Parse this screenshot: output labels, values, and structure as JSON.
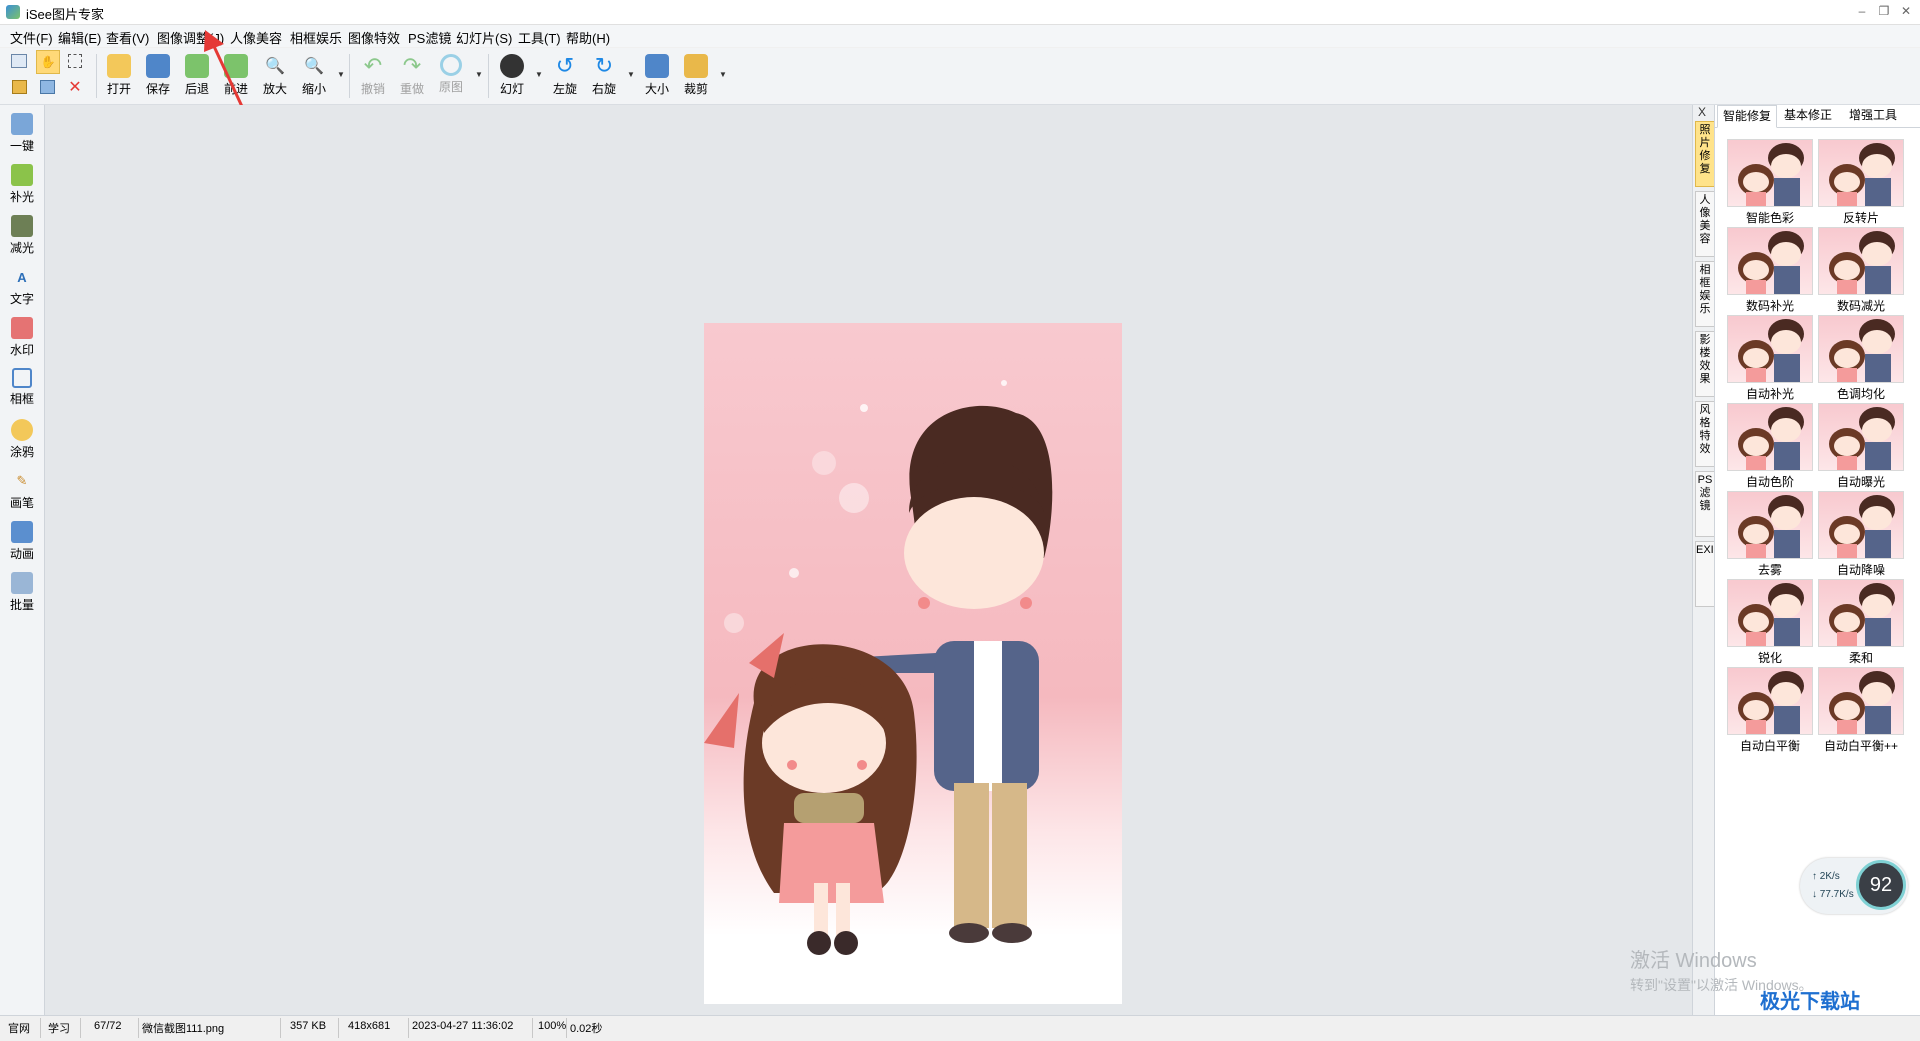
{
  "window": {
    "title": "iSee图片专家"
  },
  "menu": [
    "文件(F)",
    "编辑(E)",
    "查看(V)",
    "图像调整(J)",
    "人像美容",
    "相框娱乐",
    "图像特效",
    "PS滤镜",
    "幻灯片(S)",
    "工具(T)",
    "帮助(H)"
  ],
  "toolbar": {
    "open": "打开",
    "save": "保存",
    "back": "后退",
    "forward": "前进",
    "zoom_in": "放大",
    "zoom_out": "缩小",
    "undo": "撤销",
    "redo": "重做",
    "original": "原图",
    "slideshow": "幻灯",
    "rotate_left": "左旋",
    "rotate_right": "右旋",
    "resize": "大小",
    "crop": "裁剪"
  },
  "left_tools": [
    "一键",
    "补光",
    "减光",
    "文字",
    "水印",
    "相框",
    "涂鸦",
    "画笔",
    "动画",
    "批量"
  ],
  "side_tabs": {
    "close": "X",
    "items": [
      "照片修复",
      "人像美容",
      "相框娱乐",
      "影楼效果",
      "风格特效",
      "PS滤镜",
      "EXIF"
    ]
  },
  "right_panel": {
    "tabs": [
      "智能修复",
      "基本修正",
      "增强工具"
    ],
    "effects": [
      "智能色彩",
      "反转片",
      "数码补光",
      "数码减光",
      "自动补光",
      "色调均化",
      "自动色阶",
      "自动曝光",
      "去雾",
      "自动降噪",
      "锐化",
      "柔和",
      "自动白平衡",
      "自动白平衡++"
    ]
  },
  "status": {
    "site": "官网",
    "learn": "学习",
    "index": "67/72",
    "filename": "微信截图111.png",
    "filesize": "357 KB",
    "dimensions": "418x681",
    "datetime": "2023-04-27 11:36:02",
    "zoom": "100%",
    "time": "0.02秒"
  },
  "watermark": {
    "line1": "激活 Windows",
    "line2": "转到\"设置\"以激活 Windows。"
  },
  "net_widget": {
    "up": "2K/s",
    "down": "77.7K/s",
    "percent": "92"
  },
  "corner_logo": "极光下载站",
  "colors": {
    "accent": "#ffe38a",
    "arrow": "#e53935",
    "canvas": "#e4e7ea"
  }
}
